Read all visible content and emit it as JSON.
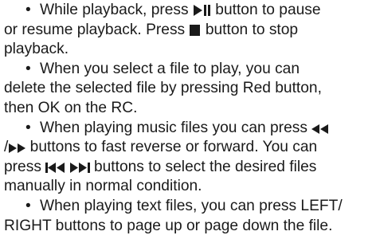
{
  "paragraphs": [
    {
      "bullet": "•",
      "lines": [
        {
          "before": "While playback, press ",
          "icon": "play-pause-icon",
          "after": " button to pause"
        },
        {
          "text": "or resume playback. Press "
        },
        {
          "text": "playback."
        }
      ],
      "line2_after_stop": " button to stop",
      "line2_icon": "stop-icon"
    },
    {
      "bullet": "•",
      "lines": [
        {
          "text": "When you select a file to play, you can"
        },
        {
          "text": "delete the selected file by pressing Red button,"
        },
        {
          "text": "then OK on the RC."
        }
      ]
    },
    {
      "bullet": "•",
      "line1": "When playing music files you can press ",
      "line1_icon": "fast-reverse-icon",
      "line2_start": "/",
      "line2_icon": "fast-forward-icon",
      "line2_text": " buttons to fast reverse or forward. You can",
      "line3_start": "press ",
      "line3_icon_a": "skip-previous-icon",
      "line3_icon_b": "skip-next-icon",
      "line3_text": " buttons to select the desired files",
      "line4": "manually in normal condition."
    },
    {
      "bullet": "•",
      "lines": [
        {
          "text": "When playing text files, you can press LEFT/"
        },
        {
          "text": "RIGHT buttons to page up or page down the file."
        }
      ]
    }
  ]
}
